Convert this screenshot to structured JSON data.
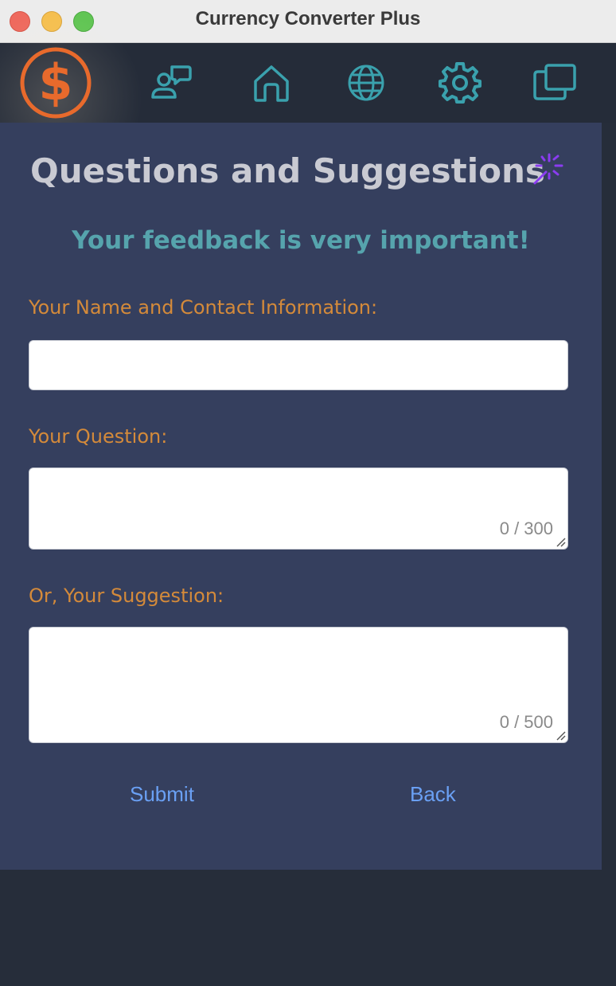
{
  "window": {
    "title": "Currency Converter Plus"
  },
  "navbar": {
    "items": [
      {
        "icon": "dollar-logo-icon"
      },
      {
        "icon": "chat-user-icon"
      },
      {
        "icon": "home-icon"
      },
      {
        "icon": "globe-icon"
      },
      {
        "icon": "gear-icon"
      },
      {
        "icon": "windows-icon"
      }
    ],
    "accent_color": "#3aa1ad",
    "logo_color": "#e86a2c"
  },
  "form": {
    "heading": "Questions and Suggestions",
    "subheading": "Your feedback is very important!",
    "name_label": "Your Name and Contact Information:",
    "name_value": "",
    "question_label": "Your Question:",
    "question_value": "",
    "question_counter": "0 / 300",
    "suggestion_label": "Or, Your Suggestion:",
    "suggestion_value": "",
    "suggestion_counter": "0 / 500",
    "submit_label": "Submit",
    "back_label": "Back"
  },
  "colors": {
    "panel_bg": "#353f5e",
    "label_color": "#d48a3a",
    "subheading_color": "#56a4ad",
    "button_color": "#6aa0f4"
  }
}
